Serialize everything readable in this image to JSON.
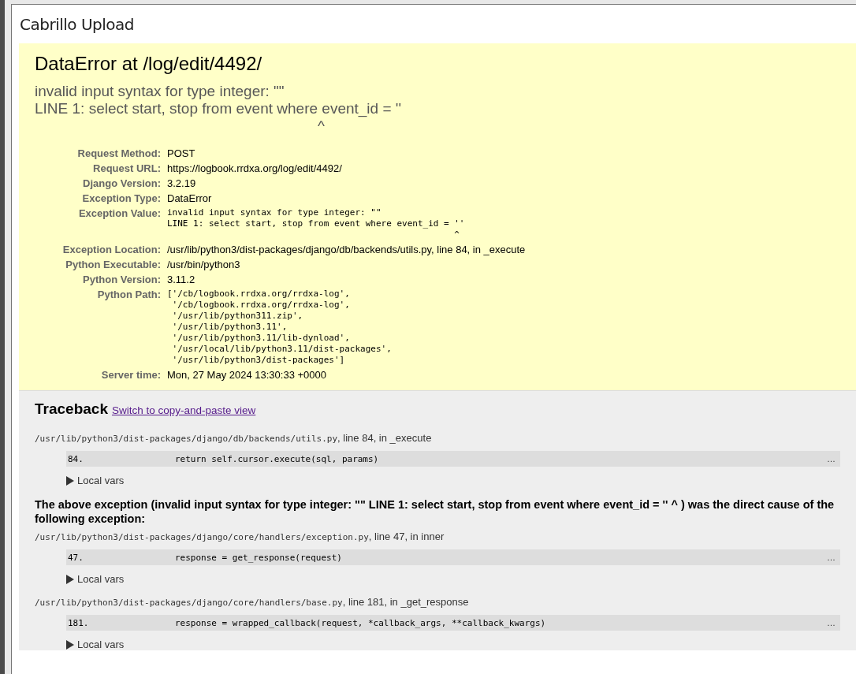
{
  "panel": {
    "title": "Cabrillo Upload"
  },
  "summary": {
    "title": "DataError at /log/edit/4492/",
    "message_lines": [
      "invalid input syntax for type integer: \"\"",
      "LINE 1: select start, stop from event where event_id = ''",
      "                                                                    ^"
    ],
    "meta": [
      {
        "label": "Request Method:",
        "kind": "text",
        "lines": [
          "POST"
        ]
      },
      {
        "label": "Request URL:",
        "kind": "text",
        "lines": [
          "https://logbook.rrdxa.org/log/edit/4492/"
        ]
      },
      {
        "label": "Django Version:",
        "kind": "text",
        "lines": [
          "3.2.19"
        ]
      },
      {
        "label": "Exception Type:",
        "kind": "text",
        "lines": [
          "DataError"
        ]
      },
      {
        "label": "Exception Value:",
        "kind": "code",
        "lines": [
          "invalid input syntax for type integer: \"\"",
          "LINE 1: select start, stop from event where event_id = ''",
          "                                                       ^"
        ]
      },
      {
        "label": "Exception Location:",
        "kind": "text",
        "lines": [
          "/usr/lib/python3/dist-packages/django/db/backends/utils.py, line 84, in _execute"
        ]
      },
      {
        "label": "Python Executable:",
        "kind": "text",
        "lines": [
          "/usr/bin/python3"
        ]
      },
      {
        "label": "Python Version:",
        "kind": "text",
        "lines": [
          "3.11.2"
        ]
      },
      {
        "label": "Python Path:",
        "kind": "code",
        "lines": [
          "['/cb/logbook.rrdxa.org/rrdxa-log',",
          " '/cb/logbook.rrdxa.org/rrdxa-log',",
          " '/usr/lib/python311.zip',",
          " '/usr/lib/python3.11',",
          " '/usr/lib/python3.11/lib-dynload',",
          " '/usr/local/lib/python3.11/dist-packages',",
          " '/usr/lib/python3/dist-packages']"
        ]
      },
      {
        "label": "Server time:",
        "kind": "text",
        "lines": [
          "Mon, 27 May 2024 13:30:33 +0000"
        ]
      }
    ]
  },
  "traceback": {
    "title": "Traceback",
    "switch_link": "Switch to copy-and-paste view",
    "items": [
      {
        "kind": "frame",
        "file": "/usr/lib/python3/dist-packages/django/db/backends/utils.py",
        "location": ", line 84, in _execute",
        "line_number": "84.",
        "code": "                return self.cursor.execute(sql, params)",
        "more": "…",
        "local_vars": "Local vars"
      },
      {
        "kind": "cause",
        "text": "The above exception (invalid input syntax for type integer: \"\" LINE 1: select start, stop from event where event_id = '' ^ ) was the direct cause of the following exception:"
      },
      {
        "kind": "frame",
        "file": "/usr/lib/python3/dist-packages/django/core/handlers/exception.py",
        "location": ", line 47, in inner",
        "line_number": "47.",
        "code": "                response = get_response(request)",
        "more": "…",
        "local_vars": "Local vars"
      },
      {
        "kind": "frame",
        "file": "/usr/lib/python3/dist-packages/django/core/handlers/base.py",
        "location": ", line 181, in _get_response",
        "line_number": "181.",
        "code": "                response = wrapped_callback(request, *callback_args, **callback_kwargs)",
        "more": "…",
        "local_vars": "Local vars"
      }
    ]
  }
}
